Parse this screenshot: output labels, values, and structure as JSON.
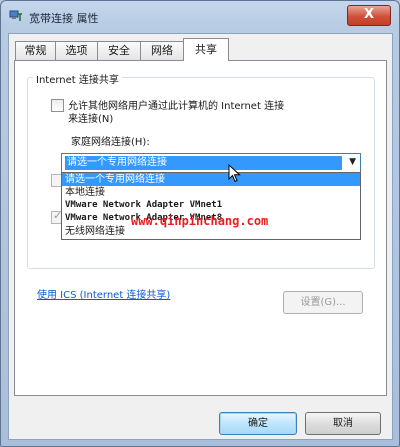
{
  "window": {
    "title": "宽带连接 属性",
    "close_label": "X"
  },
  "tabs": [
    {
      "label": "常规"
    },
    {
      "label": "选项"
    },
    {
      "label": "安全"
    },
    {
      "label": "网络"
    },
    {
      "label": "共享",
      "active": true
    }
  ],
  "sharing": {
    "group_title": "Internet 连接共享",
    "allow_share_line1": "允许其他网络用户通过此计算机的 Internet 连接",
    "allow_share_line2": "来连接(N)",
    "home_network_label": "家庭网络连接(H):",
    "combo_value": "请选一个专用网络连接",
    "dropdown_options": [
      "请选一个专用网络连接",
      "本地连接",
      "VMware Network Adapter VMnet1",
      "VMware Network Adapter VMnet8",
      "无线网络连接"
    ],
    "selected_option_index": 0,
    "allow_share_checked": false,
    "allow_control_checked": true
  },
  "ics_link": "使用 ICS (Internet 连接共享)",
  "settings_button": "设置(G)...",
  "ok_button": "确定",
  "cancel_button": "取消",
  "watermark": "www.qinpinchang.com",
  "icons": {
    "title_icon": "network-connection-icon",
    "dropdown_arrow": "chevron-down-icon",
    "cursor": "mouse-pointer-icon"
  }
}
